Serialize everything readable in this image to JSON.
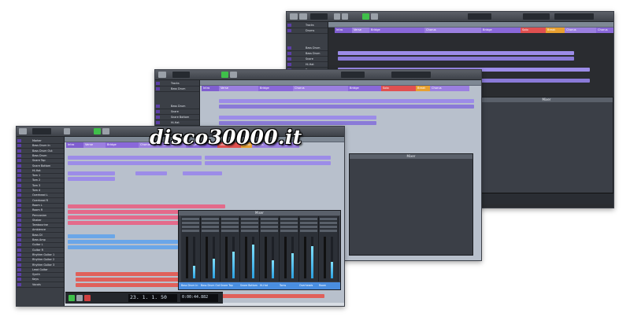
{
  "watermark": "disco30000.it",
  "colors": {
    "ui_dark": "#3b3f46",
    "arrange_bg": "#b8c0cc",
    "marker_intro": "#7f5ed0",
    "marker_verse": "#9b7fe0",
    "marker_bridge": "#8a68da",
    "marker_solo": "#e05050",
    "marker_break": "#e8a030",
    "part_purple": "#9c8ce8",
    "part_pink": "#e46a8a",
    "part_blue": "#6aa6e8",
    "part_red": "#e0605a",
    "mixer_header": "#4a8ee0",
    "transport_play": "#3fbf4a"
  },
  "windows": [
    {
      "id": "back",
      "tracks": [
        "Tracks",
        "Drums",
        "Bass Drum",
        "Bass Drum",
        "Snare",
        "Hi-Hat",
        "Toms",
        "Bass"
      ],
      "markers": [
        "Intro",
        "Verse",
        "Bridge",
        "Chorus",
        "Bridge",
        "Solo",
        "Break",
        "Chorus",
        "Chorus"
      ],
      "mixer_title": "Mixer",
      "mixer_channels": [
        "Bass Drum",
        "Bass Drum",
        "Snare",
        "Snare Bottom",
        "Hi-Hat",
        "Toms",
        "Room",
        "Overheads"
      ]
    },
    {
      "id": "middle",
      "tracks": [
        "Tracks",
        "Bass Drum",
        "Bass Drum",
        "Snare",
        "Snare Bottom",
        "Hi-Hat",
        "Toms",
        "Bass"
      ],
      "markers": [
        "Intro",
        "Verse",
        "Bridge",
        "Chorus",
        "Bridge",
        "Solo",
        "Break",
        "Chorus"
      ],
      "mixer_title": "Mixer",
      "mixer_channels": [
        "Bass Drum In",
        "Bass Drum Out",
        "Snare Top",
        "Snare Bottom",
        "Hi-Hat",
        "Toms",
        "Overheads",
        "Room"
      ]
    },
    {
      "id": "front",
      "toolbar_label": "Touch",
      "tracks": [
        "Marker",
        "Bass Drum In",
        "Bass Drum Out",
        "Bass Drum",
        "Snare Top",
        "Snare Bottom",
        "Hi-Hat",
        "Tom 1",
        "Tom 2",
        "Tom 3",
        "Tom 4",
        "Overhead L",
        "Overhead R",
        "Room L",
        "Room R",
        "Percussion",
        "Shaker",
        "Tambourine",
        "Ambience",
        "Bass DI",
        "Bass Amp",
        "Guitar L",
        "Guitar R",
        "Rhythm Guitar 1",
        "Rhythm Guitar 2",
        "Rhythm Guitar 3",
        "Lead Guitar",
        "Synth",
        "Keys",
        "Vocals"
      ],
      "markers": [
        "Intro",
        "Verse",
        "Bridge",
        "Chorus",
        "Bridge",
        "Solo",
        "Break",
        "Chorus"
      ],
      "mixer_title": "Mixer",
      "mixer_channels": [
        "Bass Drum In",
        "Bass Drum Out",
        "Snare Top",
        "Snare Bottom",
        "Hi-Hat",
        "Toms",
        "Overheads",
        "Room"
      ],
      "transport_time": "23. 1. 1. 50",
      "transport_time2": "0:00:44.882"
    }
  ]
}
